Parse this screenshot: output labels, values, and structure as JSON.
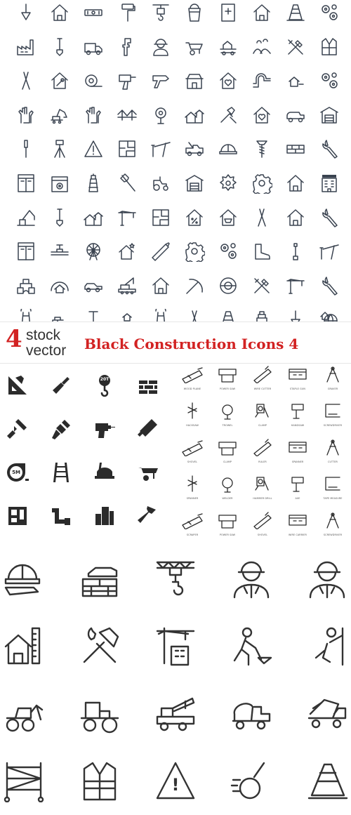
{
  "banner": {
    "logo_number": "4",
    "logo_line1": "stock",
    "logo_line2": "vector",
    "title": "Black Construction Icons 4"
  },
  "section_outline_grid": {
    "style": "thin outline",
    "color": "#3a4350",
    "columns": 10,
    "rows": [
      [
        "trowel-icon",
        "house-icon",
        "level-icon",
        "paint-roller-icon",
        "crane-hook-icon",
        "bucket-icon",
        "first-aid-door-icon",
        "house-icon",
        "traffic-cone-icon",
        "gears-icon"
      ],
      [
        "factory-icon",
        "shovel-icon",
        "truck-icon",
        "pipe-wrench-icon",
        "worker-icon",
        "wheelbarrow-icon",
        "house-cart-icon",
        "landscape-icon",
        "crossed-tools-icon",
        "safety-vest-icon"
      ],
      [
        "pliers-icon",
        "house-wrench-icon",
        "tape-measure-icon",
        "drill-icon",
        "nail-gun-icon",
        "shop-icon",
        "house-heart-icon",
        "pipe-icon",
        "house-small-icon",
        "gears-icon"
      ],
      [
        "gloves-icon",
        "excavator-icon",
        "gloves-icon",
        "bridge-icon",
        "gear-sign-icon",
        "houses-icon",
        "hammer-brush-icon",
        "house-heart-icon",
        "mixer-truck-icon",
        "warehouse-icon"
      ],
      [
        "screwdriver-icon",
        "tripod-icon",
        "warning-sign-icon",
        "floor-plan-icon",
        "barrier-icon",
        "tow-truck-icon",
        "helmet-icon",
        "screw-icon",
        "bricks-icon",
        "wrench-icon"
      ],
      [
        "window-icon",
        "box-gear-icon",
        "lighthouse-icon",
        "axe-icon",
        "tractor-icon",
        "warehouse-icon",
        "saw-blade-icon",
        "gear-icon",
        "house-icon",
        "hotel-icon"
      ],
      [
        "crane-arm-icon",
        "shovel-icon",
        "houses-icon",
        "tower-crane-icon",
        "floor-plan-icon",
        "house-percent-icon",
        "house-basket-icon",
        "pliers-icon",
        "house-icon",
        "wrench-icon"
      ],
      [
        "window-icon",
        "pipe-valve-icon",
        "ferris-wheel-icon",
        "house-star-icon",
        "saw-icon",
        "gear-icon",
        "gears-icon",
        "boot-icon",
        "spanner-icon",
        "barrier-icon"
      ],
      [
        "blocks-icon",
        "arch-house-icon",
        "car-icon",
        "crane-vehicle-icon",
        "house-icon",
        "pickaxe-icon",
        "tape-icon",
        "crossed-tools-icon",
        "tower-crane-icon",
        "wrench-icon"
      ],
      [
        "pincers-icon",
        "brick-wall-icon",
        "nail-icon",
        "hand-house-icon",
        "pincers-icon",
        "pliers-icon",
        "traffic-cone-icon",
        "stacked-cone-icon",
        "trowel-icon",
        "globe-house-icon"
      ]
    ]
  },
  "section_solid_grid": {
    "style": "solid",
    "color": "#2b2b2b",
    "rows": [
      [
        "ruler-triangle-icon",
        "trowel-icon",
        "crane-hook-icon",
        "brick-wall-icon"
      ],
      [
        "paint-roller-icon",
        "paint-brush-icon",
        "drill-icon",
        "hand-saw-icon"
      ],
      [
        "tape-measure-icon",
        "ladder-icon",
        "shovel-icon",
        "wheelbarrow-icon"
      ],
      [
        "floor-plan-icon",
        "pipe-icon",
        "building-icon",
        "hammer-icon"
      ]
    ],
    "hook_label": "20T",
    "tape_label": "5M"
  },
  "section_labeled_grid": {
    "style": "outline with captions",
    "labels": [
      [
        "WOOD PLANE",
        "POWER SAW",
        "WIRE CUTTER",
        "STAPLE GUN",
        "GRAVER"
      ],
      [
        "HACKSAW",
        "TROWEL",
        "CLAMP",
        "HANDSAW",
        "SCREWDRIVER"
      ],
      [
        "SHOVEL",
        "CLAMP",
        "RULER",
        "SPANNER",
        "CUTTER"
      ],
      [
        "SPANNER",
        "WELDER",
        "HAMMER DRILL",
        "AXE",
        "TAPE MEASURE"
      ],
      [
        "SCRAPER",
        "POWER SAW",
        "SHOVEL",
        "WIRE CARRIER",
        "SCREWDRIVER"
      ]
    ]
  },
  "section_large_grid": {
    "style": "thick outline",
    "color": "#333333",
    "rows": [
      [
        "helmet-blueprint-icon",
        "hand-bricks-icon",
        "crane-hook-icon",
        "worker-icon",
        "worker-icon"
      ],
      [
        "house-ruler-pencil-icon",
        "hammer-wrench-icon",
        "crane-building-icon",
        "worker-shoveling-icon",
        "worker-climbing-icon"
      ],
      [
        "bulldozer-icon",
        "road-roller-icon",
        "crane-truck-icon",
        "cement-mixer-icon",
        "dump-truck-icon"
      ],
      [
        "scaffolding-icon",
        "safety-vest-icon",
        "warning-triangle-icon",
        "wrecking-ball-icon",
        "traffic-cone-icon"
      ]
    ],
    "warning_mark": "!"
  }
}
